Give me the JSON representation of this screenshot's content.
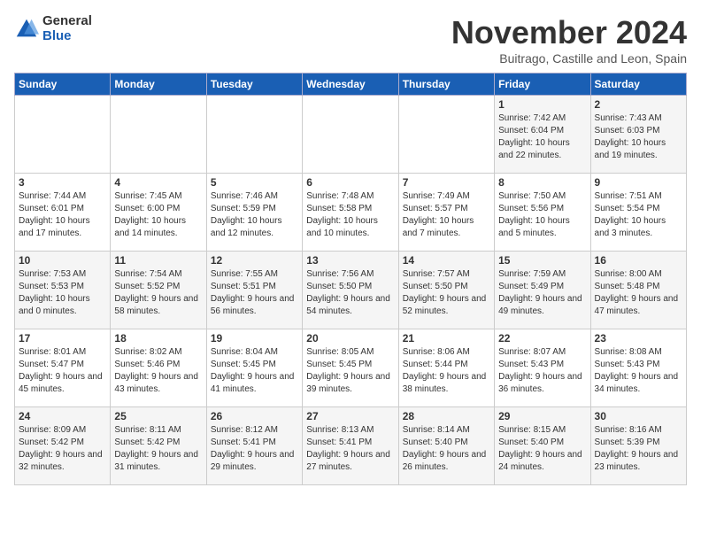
{
  "logo": {
    "general": "General",
    "blue": "Blue"
  },
  "header": {
    "month": "November 2024",
    "location": "Buitrago, Castille and Leon, Spain"
  },
  "days_of_week": [
    "Sunday",
    "Monday",
    "Tuesday",
    "Wednesday",
    "Thursday",
    "Friday",
    "Saturday"
  ],
  "weeks": [
    [
      {
        "day": "",
        "info": ""
      },
      {
        "day": "",
        "info": ""
      },
      {
        "day": "",
        "info": ""
      },
      {
        "day": "",
        "info": ""
      },
      {
        "day": "",
        "info": ""
      },
      {
        "day": "1",
        "info": "Sunrise: 7:42 AM\nSunset: 6:04 PM\nDaylight: 10 hours and 22 minutes."
      },
      {
        "day": "2",
        "info": "Sunrise: 7:43 AM\nSunset: 6:03 PM\nDaylight: 10 hours and 19 minutes."
      }
    ],
    [
      {
        "day": "3",
        "info": "Sunrise: 7:44 AM\nSunset: 6:01 PM\nDaylight: 10 hours and 17 minutes."
      },
      {
        "day": "4",
        "info": "Sunrise: 7:45 AM\nSunset: 6:00 PM\nDaylight: 10 hours and 14 minutes."
      },
      {
        "day": "5",
        "info": "Sunrise: 7:46 AM\nSunset: 5:59 PM\nDaylight: 10 hours and 12 minutes."
      },
      {
        "day": "6",
        "info": "Sunrise: 7:48 AM\nSunset: 5:58 PM\nDaylight: 10 hours and 10 minutes."
      },
      {
        "day": "7",
        "info": "Sunrise: 7:49 AM\nSunset: 5:57 PM\nDaylight: 10 hours and 7 minutes."
      },
      {
        "day": "8",
        "info": "Sunrise: 7:50 AM\nSunset: 5:56 PM\nDaylight: 10 hours and 5 minutes."
      },
      {
        "day": "9",
        "info": "Sunrise: 7:51 AM\nSunset: 5:54 PM\nDaylight: 10 hours and 3 minutes."
      }
    ],
    [
      {
        "day": "10",
        "info": "Sunrise: 7:53 AM\nSunset: 5:53 PM\nDaylight: 10 hours and 0 minutes."
      },
      {
        "day": "11",
        "info": "Sunrise: 7:54 AM\nSunset: 5:52 PM\nDaylight: 9 hours and 58 minutes."
      },
      {
        "day": "12",
        "info": "Sunrise: 7:55 AM\nSunset: 5:51 PM\nDaylight: 9 hours and 56 minutes."
      },
      {
        "day": "13",
        "info": "Sunrise: 7:56 AM\nSunset: 5:50 PM\nDaylight: 9 hours and 54 minutes."
      },
      {
        "day": "14",
        "info": "Sunrise: 7:57 AM\nSunset: 5:50 PM\nDaylight: 9 hours and 52 minutes."
      },
      {
        "day": "15",
        "info": "Sunrise: 7:59 AM\nSunset: 5:49 PM\nDaylight: 9 hours and 49 minutes."
      },
      {
        "day": "16",
        "info": "Sunrise: 8:00 AM\nSunset: 5:48 PM\nDaylight: 9 hours and 47 minutes."
      }
    ],
    [
      {
        "day": "17",
        "info": "Sunrise: 8:01 AM\nSunset: 5:47 PM\nDaylight: 9 hours and 45 minutes."
      },
      {
        "day": "18",
        "info": "Sunrise: 8:02 AM\nSunset: 5:46 PM\nDaylight: 9 hours and 43 minutes."
      },
      {
        "day": "19",
        "info": "Sunrise: 8:04 AM\nSunset: 5:45 PM\nDaylight: 9 hours and 41 minutes."
      },
      {
        "day": "20",
        "info": "Sunrise: 8:05 AM\nSunset: 5:45 PM\nDaylight: 9 hours and 39 minutes."
      },
      {
        "day": "21",
        "info": "Sunrise: 8:06 AM\nSunset: 5:44 PM\nDaylight: 9 hours and 38 minutes."
      },
      {
        "day": "22",
        "info": "Sunrise: 8:07 AM\nSunset: 5:43 PM\nDaylight: 9 hours and 36 minutes."
      },
      {
        "day": "23",
        "info": "Sunrise: 8:08 AM\nSunset: 5:43 PM\nDaylight: 9 hours and 34 minutes."
      }
    ],
    [
      {
        "day": "24",
        "info": "Sunrise: 8:09 AM\nSunset: 5:42 PM\nDaylight: 9 hours and 32 minutes."
      },
      {
        "day": "25",
        "info": "Sunrise: 8:11 AM\nSunset: 5:42 PM\nDaylight: 9 hours and 31 minutes."
      },
      {
        "day": "26",
        "info": "Sunrise: 8:12 AM\nSunset: 5:41 PM\nDaylight: 9 hours and 29 minutes."
      },
      {
        "day": "27",
        "info": "Sunrise: 8:13 AM\nSunset: 5:41 PM\nDaylight: 9 hours and 27 minutes."
      },
      {
        "day": "28",
        "info": "Sunrise: 8:14 AM\nSunset: 5:40 PM\nDaylight: 9 hours and 26 minutes."
      },
      {
        "day": "29",
        "info": "Sunrise: 8:15 AM\nSunset: 5:40 PM\nDaylight: 9 hours and 24 minutes."
      },
      {
        "day": "30",
        "info": "Sunrise: 8:16 AM\nSunset: 5:39 PM\nDaylight: 9 hours and 23 minutes."
      }
    ]
  ]
}
